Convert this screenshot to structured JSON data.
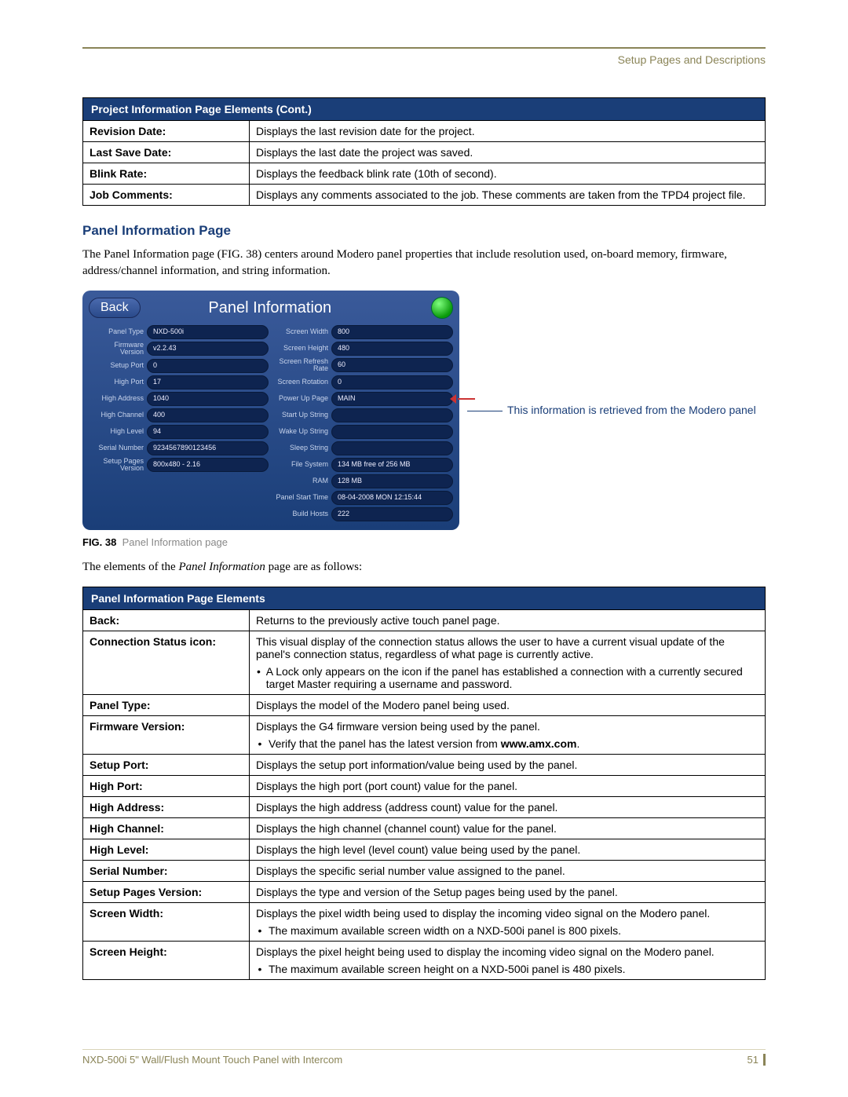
{
  "sectionTag": "Setup Pages and Descriptions",
  "table1": {
    "header": "Project Information Page Elements (Cont.)",
    "rows": [
      {
        "label": "Revision Date:",
        "desc": "Displays the last revision date for the project."
      },
      {
        "label": "Last Save Date:",
        "desc": "Displays the last date the project was saved."
      },
      {
        "label": "Blink Rate:",
        "desc": "Displays the feedback blink rate (10th of second)."
      },
      {
        "label": "Job Comments:",
        "desc": "Displays any comments associated to the job. These comments are taken from the TPD4 project file."
      }
    ]
  },
  "headingPanel": "Panel Information Page",
  "paraPanel": "The Panel Information page (FIG. 38) centers around Modero panel properties that include resolution used, on-board memory, firmware, address/channel information, and string information.",
  "panelUI": {
    "back": "Back",
    "title": "Panel Information",
    "left": [
      {
        "label": "Panel Type",
        "val": "NXD-500i"
      },
      {
        "label": "Firmware Version",
        "val": "v2.2.43"
      },
      {
        "label": "Setup Port",
        "val": "0"
      },
      {
        "label": "High Port",
        "val": "17"
      },
      {
        "label": "High Address",
        "val": "1040"
      },
      {
        "label": "High Channel",
        "val": "400"
      },
      {
        "label": "High Level",
        "val": "94"
      },
      {
        "label": "Serial Number",
        "val": "9234567890123456"
      },
      {
        "label": "Setup Pages Version",
        "val": "800x480 - 2.16"
      }
    ],
    "right": [
      {
        "label": "Screen Width",
        "val": "800"
      },
      {
        "label": "Screen Height",
        "val": "480"
      },
      {
        "label": "Screen Refresh Rate",
        "val": "60"
      },
      {
        "label": "Screen Rotation",
        "val": "0"
      },
      {
        "label": "Power Up Page",
        "val": "MAIN",
        "arrow": true
      },
      {
        "label": "Start Up String",
        "val": ""
      },
      {
        "label": "Wake Up String",
        "val": ""
      },
      {
        "label": "Sleep String",
        "val": ""
      },
      {
        "label": "File System",
        "val": "134 MB free of 256 MB"
      },
      {
        "label": "RAM",
        "val": "128 MB"
      },
      {
        "label": "Panel Start Time",
        "val": "08-04-2008 MON 12:15:44"
      },
      {
        "label": "Build Hosts",
        "val": "222"
      }
    ]
  },
  "annotation": "This information is retrieved from the Modero panel",
  "figCaption": {
    "num": "FIG. 38",
    "text": "Panel Information page"
  },
  "paraElements": {
    "prefix": "The elements of the ",
    "italic": "Panel Information",
    "suffix": " page are as follows:"
  },
  "table2": {
    "header": "Panel Information Page Elements",
    "rows": [
      {
        "label": "Back:",
        "desc": "Returns to the previously active touch panel page."
      },
      {
        "label": "Connection Status icon:",
        "desc": "This visual display of the connection status allows the user to have a current visual update of the panel's connection status, regardless of what page is currently active.",
        "bullet": "A Lock only appears on the icon if the panel has established a connection with a currently secured target Master requiring a username and password."
      },
      {
        "label": "Panel Type:",
        "desc": "Displays the model of the Modero panel being used."
      },
      {
        "label": "Firmware Version:",
        "desc": "Displays the G4 firmware version being used by the panel.",
        "bullet": "Verify that the panel has the latest version from ",
        "bulletBold": "www.amx.com",
        "bulletTail": "."
      },
      {
        "label": "Setup Port:",
        "desc": "Displays the setup port information/value being used by the panel."
      },
      {
        "label": "High Port:",
        "desc": "Displays the high port (port count) value for the panel."
      },
      {
        "label": "High Address:",
        "desc": "Displays the high address (address count) value for the panel."
      },
      {
        "label": "High Channel:",
        "desc": "Displays the high channel (channel count) value for the panel."
      },
      {
        "label": "High Level:",
        "desc": "Displays the high level (level count) value being used by the panel."
      },
      {
        "label": "Serial Number:",
        "desc": "Displays the specific serial number value assigned to the panel."
      },
      {
        "label": "Setup Pages Version:",
        "desc": "Displays the type and version of the Setup pages being used by the panel."
      },
      {
        "label": "Screen Width:",
        "desc": "Displays the pixel width being used to display the incoming video signal on the Modero panel.",
        "bullet": "The maximum available screen width on a NXD-500i panel is 800 pixels."
      },
      {
        "label": "Screen Height:",
        "desc": "Displays the pixel height being used to display the incoming video signal on the Modero panel.",
        "bullet": "The maximum available screen height on a NXD-500i panel is 480 pixels."
      }
    ]
  },
  "footer": {
    "left": "NXD-500i 5\" Wall/Flush Mount Touch Panel with Intercom",
    "page": "51"
  }
}
